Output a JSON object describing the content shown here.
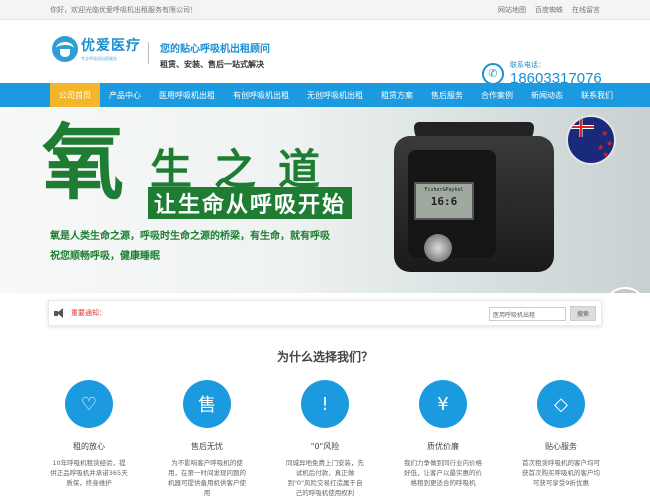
{
  "topbar": {
    "welcome": "你好，欢迎光临优爱呼吸机出租服务有限公司！",
    "links": [
      "网站地图",
      "百度蜘蛛",
      "在线留言"
    ]
  },
  "header": {
    "logo_name": "优爱医疗",
    "logo_sub": "专业呼吸机出租服务",
    "slogan_main": "您的贴心呼吸机出租顾问",
    "slogan_sub": "租赁、安装、售后一站式解决",
    "phone_label": "联系电话：",
    "phone_number": "18603317076",
    "phone_icon": "phone-icon"
  },
  "nav": {
    "items": [
      "公司首页",
      "产品中心",
      "医用呼吸机出租",
      "有创呼吸机出租",
      "无创呼吸机出租",
      "租赁方案",
      "售后服务",
      "合作案例",
      "新闻动态",
      "联系我们"
    ],
    "active_index": 0
  },
  "banner": {
    "big_char": "氧",
    "title": "生之道",
    "subtitle": "让生命从呼吸开始",
    "line1": "氧是人类生命之源，呼吸时生命之源的桥梁，有生命，就有呼吸",
    "line2": "祝您顺畅呼吸，健康睡眠",
    "device_brand": "Fisher&Paykel",
    "device_display": "16:6",
    "slide_count": 2,
    "active_slide": 1
  },
  "notice": {
    "label": "重要通知：",
    "search_value": "医用呼吸机出租",
    "search_button": "搜索"
  },
  "why": {
    "title": "为什么选择我们？",
    "features": [
      {
        "icon": "heart-icon",
        "glyph": "♡",
        "title": "租的放心",
        "desc": "10年呼吸机租赁经验，提供正品呼吸机并承诺365天质保，终身维护"
      },
      {
        "icon": "after-sale-icon",
        "glyph": "售",
        "title": "售后无忧",
        "desc": "为不影响客户呼吸机的使用，在第一时间发现问题的机器可提供备用机供客户使用"
      },
      {
        "icon": "exclamation-icon",
        "glyph": "!",
        "title": "\"0\"风险",
        "desc": "同城异地免费上门安装，先试机后付款，真正做到\"0\"风险交易打造属于自己的呼吸机使用权利"
      },
      {
        "icon": "yen-icon",
        "glyph": "¥",
        "title": "质优价廉",
        "desc": "我们力争做到同行业内价格好低，让客户以最实惠的价格租到更适合的呼吸机"
      },
      {
        "icon": "diamond-icon",
        "glyph": "◇",
        "title": "贴心服务",
        "desc": "首次租赁呼吸机的客户均可获首次购买呼吸机的客户均可获可享受9折优惠"
      }
    ]
  },
  "colors": {
    "primary": "#1c9ae0",
    "nav_active": "#f3b62b",
    "banner_green": "#1e7d33",
    "notice_red": "#d33"
  }
}
